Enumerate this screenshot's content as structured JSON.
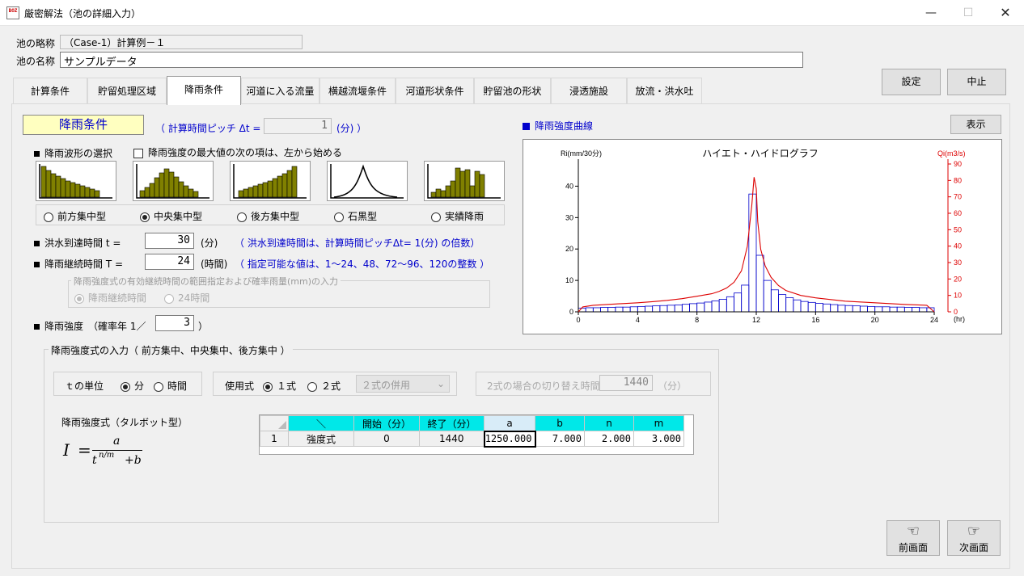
{
  "window": {
    "title": "厳密解法（池の詳細入力）",
    "icon_text": "BOZ"
  },
  "header": {
    "short_name_label": "池の略称",
    "short_name_value": "（Case-1）計算例－１",
    "name_label": "池の名称",
    "name_value": "サンプルデータ",
    "settings_button": "設定",
    "cancel_button": "中止"
  },
  "tabs": [
    {
      "label": "計算条件"
    },
    {
      "label": "貯留処理区域"
    },
    {
      "label": "降雨条件"
    },
    {
      "label": "河道に入る流量"
    },
    {
      "label": "横越流堰条件"
    },
    {
      "label": "河道形状条件"
    },
    {
      "label": "貯留池の形状"
    },
    {
      "label": "浸透施設"
    },
    {
      "label": "放流・洪水吐"
    }
  ],
  "rain": {
    "title": "降雨条件",
    "pitch_prefix": "（ 計算時間ピッチ Δt =",
    "pitch_value": "1",
    "pitch_suffix": "(分) ）",
    "waveform_label": "降雨波形の選択",
    "checkbox_label": "降雨強度の最大値の次の項は、左から始める",
    "waveform_options": [
      "前方集中型",
      "中央集中型",
      "後方集中型",
      "石黒型",
      "実績降雨"
    ],
    "waveform_selected": "中央集中型",
    "arrival_label": "洪水到達時間  t  =",
    "arrival_value": "30",
    "arrival_unit": "(分)",
    "arrival_note": "（ 洪水到達時間は、計算時間ピッチΔt= 1(分) の倍数）",
    "duration_label": "降雨継続時間  T =",
    "duration_value": "24",
    "duration_unit": "(時間)",
    "duration_note": "（ 指定可能な値は、1～24、48、72～96、120の整数 ）",
    "range_group_title": "降雨強度式の有効継続時間の範囲指定および確率雨量(mm)の入力",
    "range_options": [
      "降雨継続時間",
      "24時間"
    ],
    "intensity_label": "降雨強度　（確率年 1／",
    "intensity_value": "3",
    "intensity_suffix": "）"
  },
  "formula": {
    "group_title": "降雨強度式の入力（ 前方集中、中央集中、後方集中 ）",
    "tunit_label": "ｔの単位",
    "tunit_options": [
      "分",
      "時間"
    ],
    "use_label": "使用式",
    "use_options": [
      "１式",
      "２式"
    ],
    "combo_value": "２式の併用",
    "switch_label": "2式の場合の切り替え時間",
    "switch_value": "1440",
    "switch_unit": "（分）",
    "talbot_label": "降雨強度式（タルボット型）",
    "eq_I": "I",
    "eq_eq": "=",
    "eq_a": "a",
    "eq_t": "t",
    "eq_exp": "n/m",
    "eq_b": "+b",
    "table": {
      "headers": [
        "＼",
        "開始（分）",
        "終了（分）",
        "a",
        "b",
        "n",
        "m"
      ],
      "rows": [
        {
          "no": "1",
          "cells": [
            "強度式",
            "0",
            "1440",
            "1250.000",
            "7.000",
            "2.000",
            "3.000"
          ]
        }
      ]
    }
  },
  "chart": {
    "section_label": "降雨強度曲線",
    "show_button": "表示",
    "title": "ハイエト・ハイドログラフ",
    "left_axis_label": "Ri(mm/30分)",
    "right_axis_label": "Qi(m3/s)",
    "x_unit": "(hr)",
    "colors": {
      "bars": "#0000cc",
      "line": "#dd0000"
    }
  },
  "chart_data": {
    "type": "bar",
    "title": "ハイエト・ハイドログラフ",
    "ylabel": "Ri(mm/30分)",
    "y2label": "Qi(m3/s)",
    "xlabel": "(hr)",
    "xlim": [
      0,
      24
    ],
    "ylim": [
      0,
      45
    ],
    "y2lim": [
      0,
      90
    ],
    "x_ticks": [
      "0",
      "4",
      "8",
      "12",
      "16",
      "20",
      "24"
    ],
    "y_ticks": [
      "0",
      "10",
      "20",
      "30",
      "40"
    ],
    "y2_ticks": [
      "0",
      "10",
      "20",
      "30",
      "40",
      "50",
      "60",
      "70",
      "80",
      "90"
    ],
    "bar_width_hr": 0.5,
    "bars": [
      {
        "x": 0.0,
        "y": 1.2
      },
      {
        "x": 0.5,
        "y": 1.3
      },
      {
        "x": 1.0,
        "y": 1.3
      },
      {
        "x": 1.5,
        "y": 1.4
      },
      {
        "x": 2.0,
        "y": 1.4
      },
      {
        "x": 2.5,
        "y": 1.5
      },
      {
        "x": 3.0,
        "y": 1.5
      },
      {
        "x": 3.5,
        "y": 1.6
      },
      {
        "x": 4.0,
        "y": 1.7
      },
      {
        "x": 4.5,
        "y": 1.8
      },
      {
        "x": 5.0,
        "y": 1.9
      },
      {
        "x": 5.5,
        "y": 2.0
      },
      {
        "x": 6.0,
        "y": 2.1
      },
      {
        "x": 6.5,
        "y": 2.2
      },
      {
        "x": 7.0,
        "y": 2.4
      },
      {
        "x": 7.5,
        "y": 2.6
      },
      {
        "x": 8.0,
        "y": 2.8
      },
      {
        "x": 8.5,
        "y": 3.1
      },
      {
        "x": 9.0,
        "y": 3.5
      },
      {
        "x": 9.5,
        "y": 4.0
      },
      {
        "x": 10.0,
        "y": 4.8
      },
      {
        "x": 10.5,
        "y": 6.0
      },
      {
        "x": 11.0,
        "y": 8.5
      },
      {
        "x": 11.5,
        "y": 37.5
      },
      {
        "x": 12.0,
        "y": 18.0
      },
      {
        "x": 12.5,
        "y": 10.0
      },
      {
        "x": 13.0,
        "y": 7.0
      },
      {
        "x": 13.5,
        "y": 5.5
      },
      {
        "x": 14.0,
        "y": 4.5
      },
      {
        "x": 14.5,
        "y": 3.8
      },
      {
        "x": 15.0,
        "y": 3.3
      },
      {
        "x": 15.5,
        "y": 3.0
      },
      {
        "x": 16.0,
        "y": 2.7
      },
      {
        "x": 16.5,
        "y": 2.5
      },
      {
        "x": 17.0,
        "y": 2.3
      },
      {
        "x": 17.5,
        "y": 2.1
      },
      {
        "x": 18.0,
        "y": 2.0
      },
      {
        "x": 18.5,
        "y": 1.9
      },
      {
        "x": 19.0,
        "y": 1.8
      },
      {
        "x": 19.5,
        "y": 1.7
      },
      {
        "x": 20.0,
        "y": 1.6
      },
      {
        "x": 20.5,
        "y": 1.6
      },
      {
        "x": 21.0,
        "y": 1.5
      },
      {
        "x": 21.5,
        "y": 1.5
      },
      {
        "x": 22.0,
        "y": 1.4
      },
      {
        "x": 22.5,
        "y": 1.4
      },
      {
        "x": 23.0,
        "y": 1.3
      },
      {
        "x": 23.5,
        "y": 1.3
      }
    ],
    "line": {
      "name": "Qi",
      "x": [
        0,
        0.3,
        1,
        2,
        3,
        4,
        5,
        6,
        7,
        8,
        9,
        9.5,
        10,
        10.5,
        11,
        11.4,
        11.7,
        11.85,
        12,
        12.1,
        12.3,
        12.6,
        13,
        13.5,
        14,
        15,
        16,
        18,
        20,
        22,
        23.5,
        24
      ],
      "y": [
        0,
        3,
        4,
        4.5,
        5,
        5.5,
        6.2,
        7,
        8,
        9.5,
        11,
        12.5,
        14.5,
        18,
        25,
        40,
        65,
        82,
        75,
        55,
        38,
        28,
        21,
        16,
        13,
        10,
        8.5,
        6.5,
        5.5,
        4.5,
        4,
        0
      ]
    }
  },
  "footer": {
    "prev_label": "前画面",
    "next_label": "次画面"
  }
}
